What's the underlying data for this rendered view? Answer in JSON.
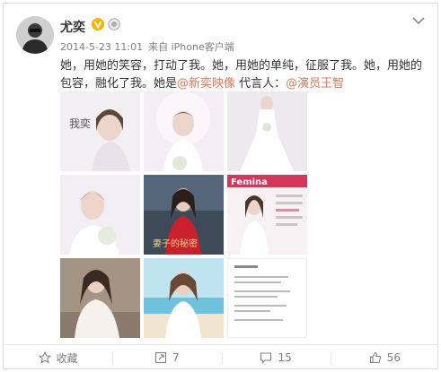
{
  "post": {
    "username": "尤奕",
    "verified_icon": "verified-v-icon",
    "member_icon": "member-badge-icon",
    "timestamp": "2014-5-23 11:01",
    "source": "来自 iPhone客户端",
    "text_part1": "她，用她的笑容，打动了我。她，用她的单纯，征服了我。她，用她的包容，融化了我。她是",
    "mention1": "@新奕映像",
    "text_part2": " 代言人：",
    "mention2": "@演员王智",
    "images": [
      {
        "name": "photo-1",
        "caption": "我奕"
      },
      {
        "name": "photo-2",
        "caption": ""
      },
      {
        "name": "photo-3",
        "caption": ""
      },
      {
        "name": "photo-4",
        "caption": ""
      },
      {
        "name": "photo-5",
        "caption": "妻子的秘密"
      },
      {
        "name": "photo-6",
        "caption": "Femina"
      },
      {
        "name": "photo-7",
        "caption": ""
      },
      {
        "name": "photo-8",
        "caption": ""
      },
      {
        "name": "photo-9",
        "caption": ""
      }
    ]
  },
  "toolbar": {
    "favorite_label": "收藏",
    "repost_count": "7",
    "comment_count": "15",
    "like_count": "56"
  },
  "colors": {
    "mention": "#eb7350",
    "verified": "#f7b500",
    "muted": "#808080"
  }
}
